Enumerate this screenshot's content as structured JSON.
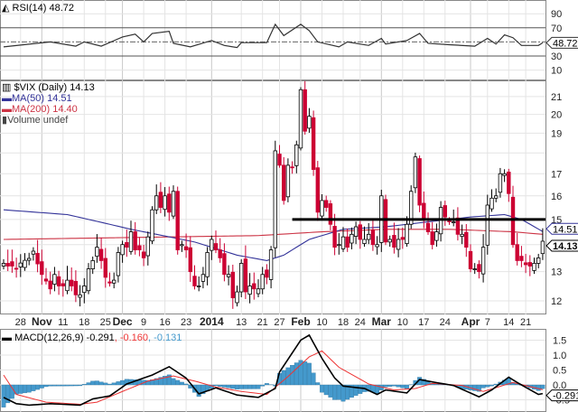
{
  "rsi_panel": {
    "title": "RSI(14) 48.72",
    "value_tag": "48.72",
    "ticks": [
      "90",
      "70",
      "30",
      "10"
    ]
  },
  "price_panel": {
    "title": "$VIX (Daily) 14.13",
    "ma50_label": "MA(50) 14.51",
    "ma200_label": "MA(200) 14.40",
    "volume_label": "Volume undef",
    "ma50_tag": "14.51",
    "close_tag": "14.13",
    "ticks": [
      "21",
      "20",
      "19",
      "17",
      "16",
      "15",
      "13",
      "12"
    ]
  },
  "x_axis": {
    "labels": [
      {
        "t": "28",
        "i": 4
      },
      {
        "t": "Nov",
        "i": 9,
        "b": true
      },
      {
        "t": "11",
        "i": 14
      },
      {
        "t": "18",
        "i": 19
      },
      {
        "t": "25",
        "i": 24
      },
      {
        "t": "Dec",
        "i": 28,
        "b": true
      },
      {
        "t": "9",
        "i": 33
      },
      {
        "t": "16",
        "i": 38
      },
      {
        "t": "23",
        "i": 43
      },
      {
        "t": "2014",
        "i": 49,
        "b": true
      },
      {
        "t": "13",
        "i": 56
      },
      {
        "t": "21",
        "i": 61
      },
      {
        "t": "27",
        "i": 65
      },
      {
        "t": "Feb",
        "i": 70,
        "b": true
      },
      {
        "t": "10",
        "i": 75
      },
      {
        "t": "18",
        "i": 80
      },
      {
        "t": "24",
        "i": 84
      },
      {
        "t": "Mar",
        "i": 89,
        "b": true
      },
      {
        "t": "10",
        "i": 94
      },
      {
        "t": "17",
        "i": 99
      },
      {
        "t": "24",
        "i": 104
      },
      {
        "t": "Apr",
        "i": 110,
        "b": true
      },
      {
        "t": "7",
        "i": 114
      },
      {
        "t": "14",
        "i": 119
      },
      {
        "t": "21",
        "i": 123
      }
    ]
  },
  "macd_panel": {
    "label_main": "MACD(12,26,9) -0.291",
    "label_signal": ", -0.160",
    "label_hist": ", -0.131",
    "value_tag": "-0.291",
    "ticks": [
      "1.5",
      "1.0",
      "0.5",
      "0.0",
      "-0.5"
    ]
  },
  "colors": {
    "up": "#ffffff",
    "down": "#cc0033",
    "ma50": "#333399",
    "ma200": "#cc3344",
    "macd": "#000000",
    "signal": "#ee3333",
    "hist": "#4499cc"
  },
  "chart_data": [
    {
      "type": "line",
      "title": "RSI(14)",
      "ylim": [
        0,
        100
      ],
      "levels": [
        70,
        30,
        50
      ],
      "points": [
        [
          0,
          43
        ],
        [
          11,
          50
        ],
        [
          17,
          44
        ],
        [
          19,
          50
        ],
        [
          23,
          44
        ],
        [
          28,
          57
        ],
        [
          31,
          61
        ],
        [
          33,
          50
        ],
        [
          35,
          62
        ],
        [
          39,
          65
        ],
        [
          40,
          48
        ],
        [
          44,
          43
        ],
        [
          49,
          52
        ],
        [
          52,
          45
        ],
        [
          55,
          42
        ],
        [
          56,
          49
        ],
        [
          62,
          49
        ],
        [
          64,
          75
        ],
        [
          66,
          59
        ],
        [
          70,
          75
        ],
        [
          72,
          66
        ],
        [
          74,
          50
        ],
        [
          79,
          43
        ],
        [
          81,
          50
        ],
        [
          86,
          45
        ],
        [
          89,
          55
        ],
        [
          90,
          47
        ],
        [
          95,
          52
        ],
        [
          98,
          62
        ],
        [
          100,
          48
        ],
        [
          105,
          46
        ],
        [
          111,
          44
        ],
        [
          114,
          55
        ],
        [
          116,
          47
        ],
        [
          118,
          60
        ],
        [
          120,
          56
        ],
        [
          122,
          45
        ],
        [
          126,
          45
        ],
        [
          127,
          48.72
        ]
      ]
    },
    {
      "type": "candlestick",
      "title": "$VIX (Daily)",
      "scale": "log",
      "ylim": [
        11.5,
        22
      ],
      "resistance": 15,
      "closes": [
        13.3,
        13.2,
        13.2,
        13.09,
        13.31,
        13.41,
        13.48,
        13.75,
        13.28,
        12.9,
        12.67,
        12.4,
        12.9,
        12.5,
        12.5,
        12.7,
        12.5,
        12.2,
        12.2,
        12.5,
        13.1,
        13.4,
        13.9,
        13.4,
        12.8,
        12.6,
        12.7,
        13.7,
        14.0,
        13.9,
        14.5,
        13.8,
        13.8,
        13.5,
        14.3,
        15.4,
        16.0,
        15.5,
        16.0,
        15.3,
        16.2,
        13.8,
        14.0,
        13.8,
        13.0,
        12.5,
        12.5,
        12.9,
        13.7,
        14.2,
        13.8,
        13.5,
        12.9,
        12.9,
        12.1,
        12.3,
        13.3,
        12.3,
        12.5,
        12.4,
        12.4,
        12.9,
        12.8,
        13.8,
        18.1,
        17.4,
        15.8,
        17.4,
        17.3,
        18.4,
        21.4,
        19.1,
        19.9,
        17.2,
        15.3,
        15.8,
        15.5,
        14.8,
        13.9,
        14.0,
        14.3,
        13.9,
        14.4,
        14.7,
        14.2,
        14.2,
        14.4,
        14.0,
        14.0,
        16.0,
        14.1,
        14.2,
        13.9,
        14.2,
        14.2,
        14.8,
        16.2,
        17.8,
        15.6,
        15.0,
        14.5,
        14.0,
        14.5,
        15.5,
        15.1,
        14.9,
        14.9,
        14.4,
        14.4,
        13.9,
        13.1,
        13.1,
        13.0,
        13.9,
        15.6,
        15.9,
        16.0,
        17.0,
        17.0,
        16.1,
        14.0,
        13.4,
        13.4,
        13.25,
        13.2,
        13.3,
        13.5,
        14.13
      ],
      "ma50": [
        [
          0,
          15.4
        ],
        [
          15,
          15.2
        ],
        [
          30,
          14.6
        ],
        [
          45,
          14.1
        ],
        [
          55,
          13.6
        ],
        [
          62,
          13.4
        ],
        [
          66,
          13.6
        ],
        [
          72,
          14.2
        ],
        [
          80,
          14.6
        ],
        [
          90,
          14.7
        ],
        [
          100,
          14.9
        ],
        [
          110,
          15.1
        ],
        [
          118,
          15.2
        ],
        [
          122,
          15.0
        ],
        [
          127,
          14.51
        ]
      ],
      "ma200": [
        [
          0,
          14.2
        ],
        [
          20,
          14.25
        ],
        [
          40,
          14.3
        ],
        [
          60,
          14.35
        ],
        [
          75,
          14.5
        ],
        [
          90,
          14.6
        ],
        [
          105,
          14.6
        ],
        [
          120,
          14.5
        ],
        [
          127,
          14.4
        ]
      ]
    },
    {
      "type": "line",
      "title": "MACD(12,26,9)",
      "ylim": [
        -0.9,
        1.9
      ],
      "macd": [
        [
          0,
          -0.42
        ],
        [
          3,
          -0.63
        ],
        [
          6,
          -0.68
        ],
        [
          11,
          -0.63
        ],
        [
          18,
          -0.68
        ],
        [
          21,
          -0.47
        ],
        [
          25,
          -0.37
        ],
        [
          29,
          0.03
        ],
        [
          32,
          0.18
        ],
        [
          35,
          0.33
        ],
        [
          39,
          0.61
        ],
        [
          43,
          0.23
        ],
        [
          46,
          -0.3
        ],
        [
          50,
          -0.1
        ],
        [
          55,
          -0.34
        ],
        [
          60,
          -0.42
        ],
        [
          64,
          -0.12
        ],
        [
          65,
          0.43
        ],
        [
          70,
          1.5
        ],
        [
          72,
          1.67
        ],
        [
          75,
          0.89
        ],
        [
          78,
          0.23
        ],
        [
          80,
          -0.04
        ],
        [
          85,
          -0.12
        ],
        [
          88,
          -0.32
        ],
        [
          90,
          -0.17
        ],
        [
          95,
          -0.27
        ],
        [
          98,
          0.18
        ],
        [
          101,
          0.1
        ],
        [
          106,
          -0.02
        ],
        [
          112,
          -0.4
        ],
        [
          115,
          -0.17
        ],
        [
          119,
          0.26
        ],
        [
          121,
          0.08
        ],
        [
          126,
          -0.32
        ],
        [
          127,
          -0.291
        ]
      ],
      "signal": [
        [
          0,
          0.33
        ],
        [
          3,
          -0.32
        ],
        [
          10,
          -0.58
        ],
        [
          18,
          -0.65
        ],
        [
          22,
          -0.58
        ],
        [
          28,
          -0.22
        ],
        [
          34,
          0.13
        ],
        [
          40,
          0.3
        ],
        [
          45,
          0.13
        ],
        [
          50,
          -0.07
        ],
        [
          56,
          -0.22
        ],
        [
          62,
          -0.32
        ],
        [
          67,
          0.28
        ],
        [
          72,
          0.94
        ],
        [
          75,
          1.14
        ],
        [
          79,
          0.59
        ],
        [
          86,
          0.03
        ],
        [
          92,
          -0.17
        ],
        [
          97,
          -0.12
        ],
        [
          101,
          0.05
        ],
        [
          108,
          -0.02
        ],
        [
          113,
          -0.22
        ],
        [
          120,
          0.08
        ],
        [
          127,
          -0.16
        ]
      ]
    }
  ]
}
